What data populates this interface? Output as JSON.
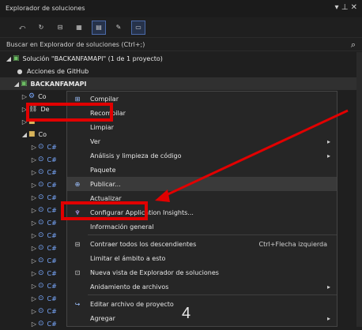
{
  "window": {
    "title": "Explorador de soluciones",
    "controls": "▾ ⊥ ✕"
  },
  "toolbar": {
    "icons": [
      "back",
      "refresh",
      "collapse",
      "show-all",
      "properties",
      "wrench",
      "preview"
    ]
  },
  "search": {
    "placeholder": "Buscar en Explorador de soluciones (Ctrl+;)"
  },
  "tree": {
    "solution_label": "Solución \"BACKANFAMAPI\" (1 de 1 proyecto)",
    "github_label": "Acciones de GitHub",
    "project_label": "BACKANFAMAPI",
    "child1": "Co",
    "child2": "De",
    "child3": "",
    "child4": "Co",
    "cs_prefix": "C#"
  },
  "menu": {
    "items": [
      {
        "label": "Compilar"
      },
      {
        "label": "Recompilar"
      },
      {
        "label": "Limpiar"
      },
      {
        "label": "Ver"
      },
      {
        "label": "Análisis y limpieza de código"
      },
      {
        "label": "Paquete"
      },
      {
        "label": "Publicar..."
      },
      {
        "label": "Actualizar"
      },
      {
        "label": "Configurar Application Insights..."
      },
      {
        "label": "Información general"
      },
      {
        "label": "Contraer todos los descendientes",
        "shortcut": "Ctrl+Flecha izquierda"
      },
      {
        "label": "Limitar el ámbito a esto"
      },
      {
        "label": "Nueva vista de Explorador de soluciones"
      },
      {
        "label": "Anidamiento de archivos"
      },
      {
        "label": "Editar archivo de proyecto"
      },
      {
        "label": "Agregar"
      }
    ]
  },
  "annotation": {
    "page_number": "4",
    "highlight_color": "#e10000"
  }
}
